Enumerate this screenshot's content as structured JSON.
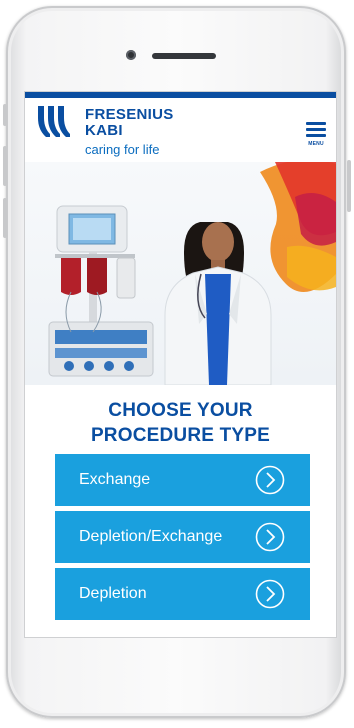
{
  "brand": {
    "name_line1": "FRESENIUS",
    "name_line2": "KABI",
    "tagline": "caring for life",
    "color": "#0a4ea1"
  },
  "menu": {
    "label": "MENU",
    "icon": "hamburger-icon"
  },
  "heading": {
    "line1": "CHOOSE YOUR",
    "line2": "PROCEDURE TYPE"
  },
  "procedures": [
    {
      "label": "Exchange",
      "icon": "chevron-circle-right-icon"
    },
    {
      "label": "Depletion/Exchange",
      "icon": "chevron-circle-right-icon"
    },
    {
      "label": "Depletion",
      "icon": "chevron-circle-right-icon"
    }
  ],
  "colors": {
    "accent": "#1aa0de",
    "brand": "#0a4ea1"
  }
}
